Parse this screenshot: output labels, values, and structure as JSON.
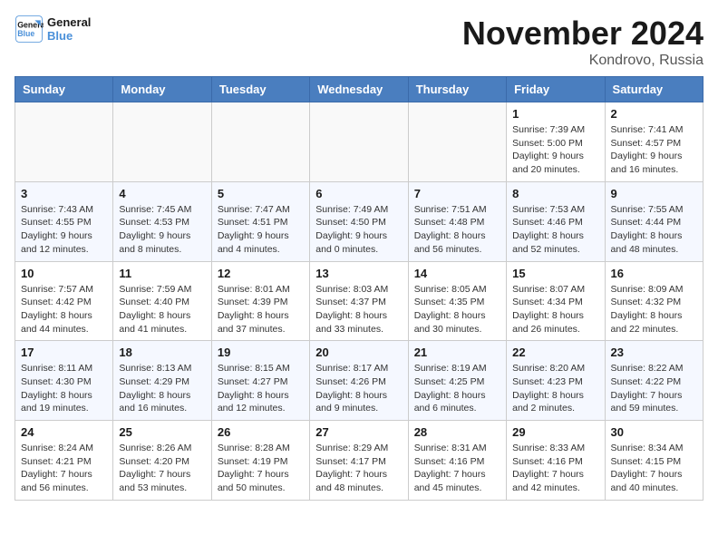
{
  "header": {
    "logo": {
      "line1": "General",
      "line2": "Blue"
    },
    "title": "November 2024",
    "location": "Kondrovo, Russia"
  },
  "days_of_week": [
    "Sunday",
    "Monday",
    "Tuesday",
    "Wednesday",
    "Thursday",
    "Friday",
    "Saturday"
  ],
  "weeks": [
    [
      {
        "day": "",
        "info": ""
      },
      {
        "day": "",
        "info": ""
      },
      {
        "day": "",
        "info": ""
      },
      {
        "day": "",
        "info": ""
      },
      {
        "day": "",
        "info": ""
      },
      {
        "day": "1",
        "info": "Sunrise: 7:39 AM\nSunset: 5:00 PM\nDaylight: 9 hours\nand 20 minutes."
      },
      {
        "day": "2",
        "info": "Sunrise: 7:41 AM\nSunset: 4:57 PM\nDaylight: 9 hours\nand 16 minutes."
      }
    ],
    [
      {
        "day": "3",
        "info": "Sunrise: 7:43 AM\nSunset: 4:55 PM\nDaylight: 9 hours\nand 12 minutes."
      },
      {
        "day": "4",
        "info": "Sunrise: 7:45 AM\nSunset: 4:53 PM\nDaylight: 9 hours\nand 8 minutes."
      },
      {
        "day": "5",
        "info": "Sunrise: 7:47 AM\nSunset: 4:51 PM\nDaylight: 9 hours\nand 4 minutes."
      },
      {
        "day": "6",
        "info": "Sunrise: 7:49 AM\nSunset: 4:50 PM\nDaylight: 9 hours\nand 0 minutes."
      },
      {
        "day": "7",
        "info": "Sunrise: 7:51 AM\nSunset: 4:48 PM\nDaylight: 8 hours\nand 56 minutes."
      },
      {
        "day": "8",
        "info": "Sunrise: 7:53 AM\nSunset: 4:46 PM\nDaylight: 8 hours\nand 52 minutes."
      },
      {
        "day": "9",
        "info": "Sunrise: 7:55 AM\nSunset: 4:44 PM\nDaylight: 8 hours\nand 48 minutes."
      }
    ],
    [
      {
        "day": "10",
        "info": "Sunrise: 7:57 AM\nSunset: 4:42 PM\nDaylight: 8 hours\nand 44 minutes."
      },
      {
        "day": "11",
        "info": "Sunrise: 7:59 AM\nSunset: 4:40 PM\nDaylight: 8 hours\nand 41 minutes."
      },
      {
        "day": "12",
        "info": "Sunrise: 8:01 AM\nSunset: 4:39 PM\nDaylight: 8 hours\nand 37 minutes."
      },
      {
        "day": "13",
        "info": "Sunrise: 8:03 AM\nSunset: 4:37 PM\nDaylight: 8 hours\nand 33 minutes."
      },
      {
        "day": "14",
        "info": "Sunrise: 8:05 AM\nSunset: 4:35 PM\nDaylight: 8 hours\nand 30 minutes."
      },
      {
        "day": "15",
        "info": "Sunrise: 8:07 AM\nSunset: 4:34 PM\nDaylight: 8 hours\nand 26 minutes."
      },
      {
        "day": "16",
        "info": "Sunrise: 8:09 AM\nSunset: 4:32 PM\nDaylight: 8 hours\nand 22 minutes."
      }
    ],
    [
      {
        "day": "17",
        "info": "Sunrise: 8:11 AM\nSunset: 4:30 PM\nDaylight: 8 hours\nand 19 minutes."
      },
      {
        "day": "18",
        "info": "Sunrise: 8:13 AM\nSunset: 4:29 PM\nDaylight: 8 hours\nand 16 minutes."
      },
      {
        "day": "19",
        "info": "Sunrise: 8:15 AM\nSunset: 4:27 PM\nDaylight: 8 hours\nand 12 minutes."
      },
      {
        "day": "20",
        "info": "Sunrise: 8:17 AM\nSunset: 4:26 PM\nDaylight: 8 hours\nand 9 minutes."
      },
      {
        "day": "21",
        "info": "Sunrise: 8:19 AM\nSunset: 4:25 PM\nDaylight: 8 hours\nand 6 minutes."
      },
      {
        "day": "22",
        "info": "Sunrise: 8:20 AM\nSunset: 4:23 PM\nDaylight: 8 hours\nand 2 minutes."
      },
      {
        "day": "23",
        "info": "Sunrise: 8:22 AM\nSunset: 4:22 PM\nDaylight: 7 hours\nand 59 minutes."
      }
    ],
    [
      {
        "day": "24",
        "info": "Sunrise: 8:24 AM\nSunset: 4:21 PM\nDaylight: 7 hours\nand 56 minutes."
      },
      {
        "day": "25",
        "info": "Sunrise: 8:26 AM\nSunset: 4:20 PM\nDaylight: 7 hours\nand 53 minutes."
      },
      {
        "day": "26",
        "info": "Sunrise: 8:28 AM\nSunset: 4:19 PM\nDaylight: 7 hours\nand 50 minutes."
      },
      {
        "day": "27",
        "info": "Sunrise: 8:29 AM\nSunset: 4:17 PM\nDaylight: 7 hours\nand 48 minutes."
      },
      {
        "day": "28",
        "info": "Sunrise: 8:31 AM\nSunset: 4:16 PM\nDaylight: 7 hours\nand 45 minutes."
      },
      {
        "day": "29",
        "info": "Sunrise: 8:33 AM\nSunset: 4:16 PM\nDaylight: 7 hours\nand 42 minutes."
      },
      {
        "day": "30",
        "info": "Sunrise: 8:34 AM\nSunset: 4:15 PM\nDaylight: 7 hours\nand 40 minutes."
      }
    ]
  ]
}
